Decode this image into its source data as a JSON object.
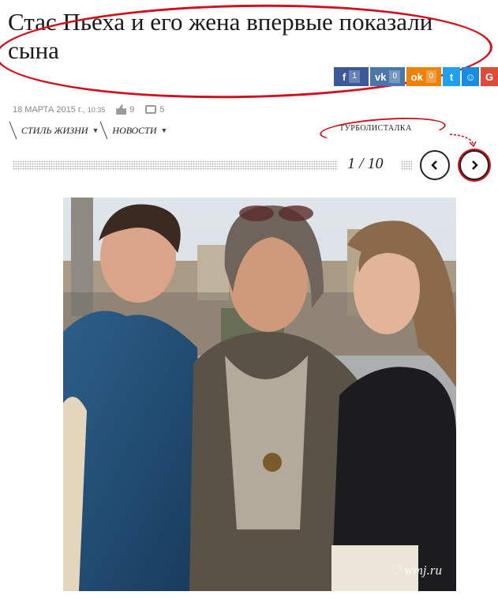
{
  "article": {
    "title": "Стас Пьеха и его жена впервые показали сына",
    "date": "18 МАРТА 2015 г.,",
    "time": "10:35",
    "likes": "9",
    "comments": "5"
  },
  "share": {
    "facebook": {
      "icon": "facebook-icon",
      "glyph": "f",
      "count": "1",
      "color": "#3b5998"
    },
    "vk": {
      "icon": "vk-icon",
      "glyph": "vk",
      "count": "0",
      "color": "#4a76a8"
    },
    "ok": {
      "icon": "odnoklassniki-icon",
      "glyph": "ok",
      "count": "0",
      "color": "#ee8208"
    },
    "twitter": {
      "icon": "twitter-icon",
      "glyph": "t",
      "color": "#1da1f2"
    },
    "mailru": {
      "icon": "mailru-icon",
      "glyph": "☺",
      "color": "#168de2"
    },
    "gplus": {
      "icon": "google-plus-icon",
      "glyph": "G",
      "color": "#dd4b39"
    }
  },
  "categories": [
    {
      "label": "Стиль жизни"
    },
    {
      "label": "Новости"
    }
  ],
  "turbo_label": "ТУРБОЛИСТАЛКА",
  "gallery": {
    "counter": "1 / 10",
    "watermark": "wmj.ru"
  },
  "colors": {
    "accent_red": "#d0121e"
  }
}
